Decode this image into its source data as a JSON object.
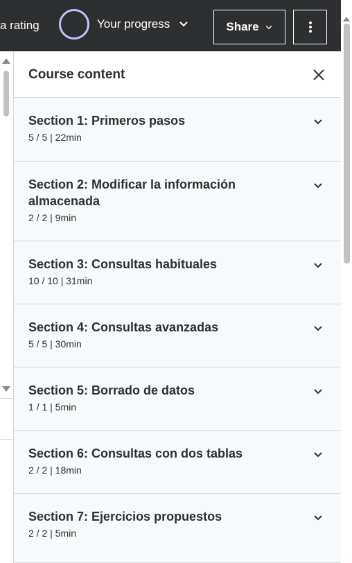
{
  "header": {
    "rate_text": "a rating",
    "progress_label": "Your progress",
    "share_label": "Share"
  },
  "panel": {
    "title": "Course content",
    "sections": [
      {
        "title": "Section 1: Primeros pasos",
        "meta": "5 / 5 | 22min"
      },
      {
        "title": "Section 2: Modificar la información almacenada",
        "meta": "2 / 2 | 9min"
      },
      {
        "title": "Section 3: Consultas habituales",
        "meta": "10 / 10 | 31min"
      },
      {
        "title": "Section 4: Consultas avanzadas",
        "meta": "5 / 5 | 30min"
      },
      {
        "title": "Section 5: Borrado de datos",
        "meta": "1 / 1 | 5min"
      },
      {
        "title": "Section 6: Consultas con dos tablas",
        "meta": "2 / 2 | 18min"
      },
      {
        "title": "Section 7: Ejercicios propuestos",
        "meta": "2 / 2 | 5min"
      }
    ]
  },
  "icons": {
    "progress": "progress-ring-icon",
    "progress_dropdown": "chevron-down-icon",
    "share_dropdown": "chevron-down-icon",
    "more": "more-vertical-icon",
    "close": "close-icon",
    "section_toggle": "chevron-down-icon"
  },
  "colors": {
    "header_bg": "#2d2f31",
    "panel_bg": "#f7f9fa",
    "progress_ring": "#c0c4fc",
    "divider": "#d1d7dc",
    "text": "#2d2f31"
  }
}
